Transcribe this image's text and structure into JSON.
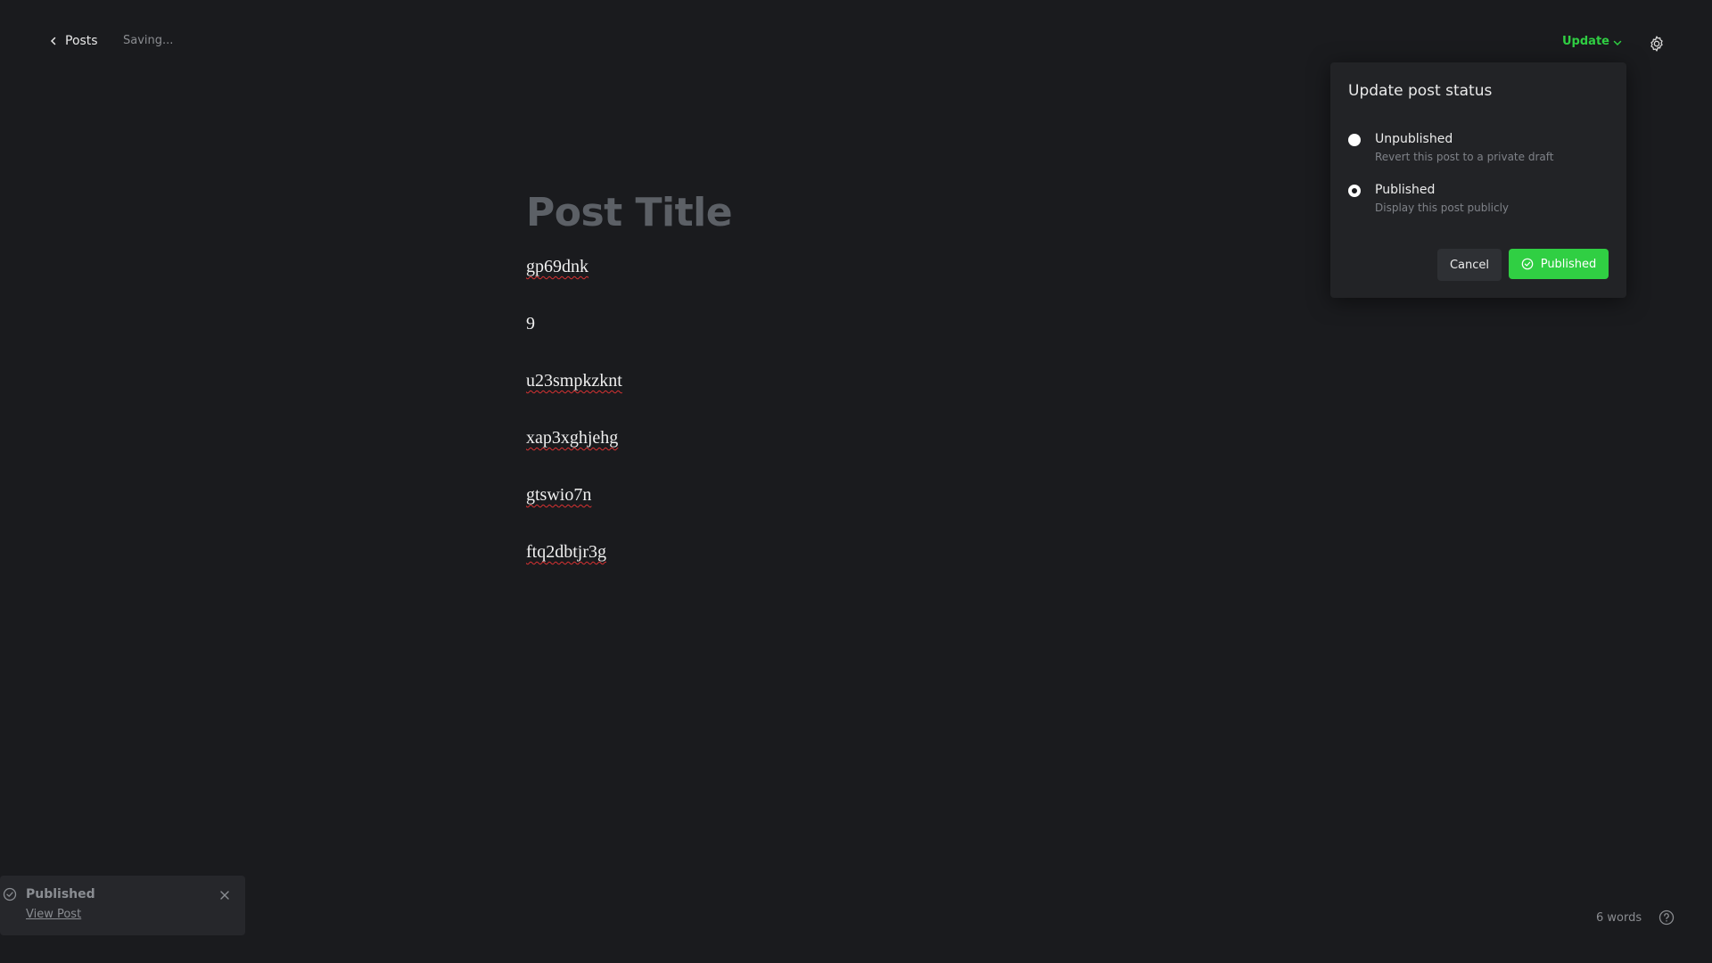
{
  "topbar": {
    "back_label": "Posts",
    "saving_text": "Saving...",
    "update_label": "Update"
  },
  "editor": {
    "title_placeholder": "Post Title",
    "paragraphs": [
      "gp69dnk",
      "9",
      "u23smpkzknt",
      "xap3xghjehg",
      "gtswio7n",
      "ftq2dbtjr3g"
    ]
  },
  "status_popover": {
    "title": "Update post status",
    "options": [
      {
        "label": "Unpublished",
        "description": "Revert this post to a private draft",
        "selected": false
      },
      {
        "label": "Published",
        "description": "Display this post publicly",
        "selected": true
      }
    ],
    "cancel_label": "Cancel",
    "confirm_label": "Published"
  },
  "toast": {
    "title": "Published",
    "link_label": "View Post"
  },
  "footer": {
    "word_count": "6 words"
  },
  "colors": {
    "background": "#1a1b1e",
    "accent_green": "#30cf43",
    "popover_bg": "#222326"
  }
}
